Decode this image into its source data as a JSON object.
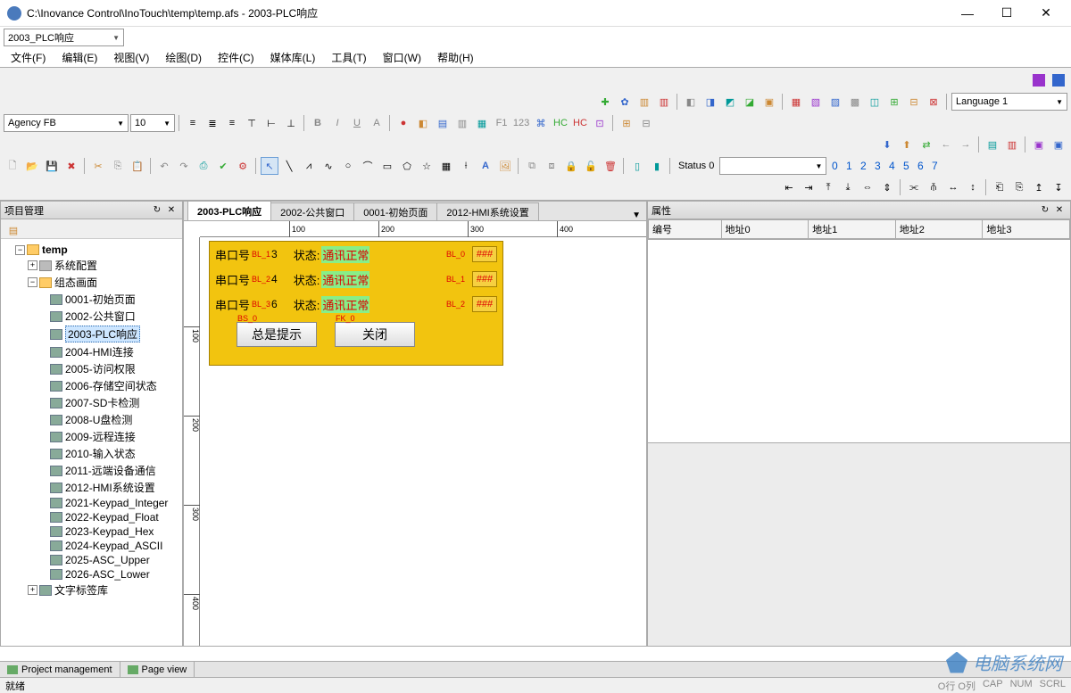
{
  "window": {
    "title": "C:\\Inovance Control\\InoTouch\\temp\\temp.afs - 2003-PLC响应"
  },
  "titleCombo": "2003_PLC响应",
  "menu": [
    "文件(F)",
    "编辑(E)",
    "视图(V)",
    "绘图(D)",
    "控件(C)",
    "媒体库(L)",
    "工具(T)",
    "窗口(W)",
    "帮助(H)"
  ],
  "fontCombo": "Agency FB",
  "sizeCombo": "10",
  "langCombo": "Language 1",
  "statusLabel": "Status 0",
  "numberBar": [
    "0",
    "1",
    "2",
    "3",
    "4",
    "5",
    "6",
    "7"
  ],
  "projectPanel": {
    "title": "项目管理"
  },
  "tree": {
    "root": "temp",
    "sysConfig": "系统配置",
    "hmiGroup": "组态画面",
    "items": [
      "0001-初始页面",
      "2002-公共窗口",
      "2003-PLC响应",
      "2004-HMI连接",
      "2005-访问权限",
      "2006-存储空间状态",
      "2007-SD卡检测",
      "2008-U盘检测",
      "2009-远程连接",
      "2010-输入状态",
      "2011-远端设备通信",
      "2012-HMI系统设置",
      "2021-Keypad_Integer",
      "2022-Keypad_Float",
      "2023-Keypad_Hex",
      "2024-Keypad_ASCII",
      "2025-ASC_Upper",
      "2026-ASC_Lower"
    ],
    "selectedIndex": 2,
    "textLib": "文字标签库"
  },
  "tabs": [
    "2003-PLC响应",
    "2002-公共窗口",
    "0001-初始页面",
    "2012-HMI系统设置"
  ],
  "activeTab": 0,
  "rulerH": [
    "100",
    "200",
    "300",
    "400"
  ],
  "rulerV": [
    "100",
    "200",
    "300",
    "400"
  ],
  "screen": {
    "rows": [
      {
        "label": "串口号",
        "idTag": "BL_1",
        "idVal": "3",
        "statL": "状态:",
        "statV": "通讯正常",
        "bl": "BL_0",
        "hash": "###"
      },
      {
        "label": "串口号",
        "idTag": "BL_2",
        "idVal": "4",
        "statL": "状态:",
        "statV": "通讯正常",
        "bl": "BL_1",
        "hash": "###"
      },
      {
        "label": "串口号",
        "idTag": "BL_3",
        "idVal": "6",
        "statL": "状态:",
        "statV": "通讯正常",
        "bl": "BL_2",
        "hash": "###"
      }
    ],
    "btn1": {
      "tag": "BS_0",
      "label": "总是提示"
    },
    "btn2": {
      "tag": "FK_0",
      "label": "关闭"
    }
  },
  "propsPanel": {
    "title": "属性",
    "columns": [
      "编号",
      "地址0",
      "地址1",
      "地址2",
      "地址3"
    ]
  },
  "bottomTabs": [
    "Project management",
    "Page view"
  ],
  "statusBar": {
    "left": "就绪",
    "right": [
      "O行 O列",
      "CAP",
      "NUM",
      "SCRL"
    ]
  },
  "watermark": "电脑系统网"
}
